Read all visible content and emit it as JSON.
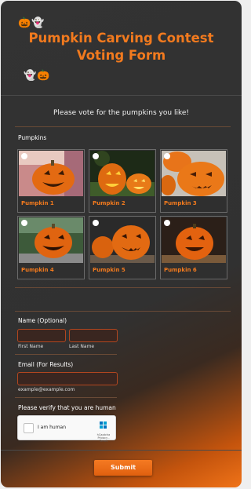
{
  "header": {
    "title_line1": "Pumpkin Carving Contest",
    "title_line2": "Voting Form",
    "deco_top": "🎃👻",
    "deco_bottom": "👻🎃"
  },
  "subtitle": "Please vote for the pumpkins you like!",
  "pumpkins_section": {
    "label": "Pumpkins",
    "options": [
      {
        "name": "Pumpkin 1"
      },
      {
        "name": "Pumpkin 2"
      },
      {
        "name": "Pumpkin 3"
      },
      {
        "name": "Pumpkin 4"
      },
      {
        "name": "Pumpkin 5"
      },
      {
        "name": "Pumpkin 6"
      }
    ]
  },
  "name_field": {
    "label": "Name (Optional)",
    "first_sublabel": "First Name",
    "last_sublabel": "Last Name"
  },
  "email_field": {
    "label": "Email (For Results)",
    "sublabel": "example@example.com"
  },
  "verify": {
    "label": "Please verify that you are human",
    "captcha_text": "I am human",
    "captcha_brand": "hCaptcha",
    "captcha_links": "Privacy - Terms"
  },
  "submit_label": "Submit",
  "colors": {
    "accent": "#f27a1e",
    "background": "#333333",
    "input_border": "#b2461f"
  }
}
